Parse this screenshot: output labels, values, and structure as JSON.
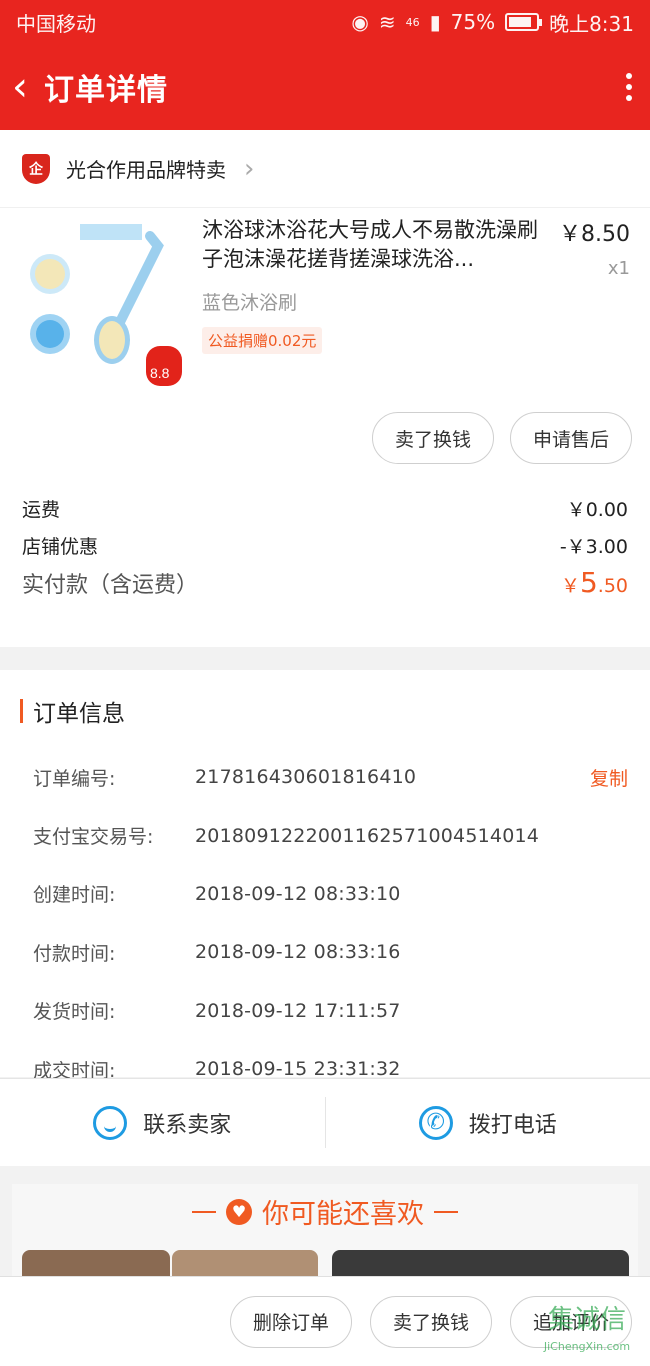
{
  "status": {
    "carrier": "中国移动",
    "network": "46",
    "battery": "75%",
    "time": "晚上8:31"
  },
  "nav": {
    "title": "订单详情"
  },
  "store": {
    "badge": "企",
    "name": "光合作用品牌特卖"
  },
  "product": {
    "title": "沐浴球沐浴花大号成人不易散洗澡刷子泡沫澡花搓背搓澡球洗浴...",
    "spec": "蓝色沐浴刷",
    "tag": "公益捐赠0.02元",
    "price": "￥8.50",
    "qty": "x1",
    "thumb_price_tag": "8.8"
  },
  "item_buttons": {
    "sell": "卖了换钱",
    "after_sale": "申请售后"
  },
  "fees": {
    "shipping_label": "运费",
    "shipping_value": "￥0.00",
    "discount_label": "店铺优惠",
    "discount_value": "-￥3.00",
    "paid_label": "实付款（含运费）",
    "paid_yen": "￥",
    "paid_int": "5",
    "paid_dec": ".50"
  },
  "order_info": {
    "title": "订单信息",
    "copy_label": "复制",
    "rows": [
      {
        "label": "订单编号:",
        "value": "217816430601816410"
      },
      {
        "label": "支付宝交易号:",
        "value": "2018091222001162571004514014"
      },
      {
        "label": "创建时间:",
        "value": "2018-09-12 08:33:10"
      },
      {
        "label": "付款时间:",
        "value": "2018-09-12 08:33:16"
      },
      {
        "label": "发货时间:",
        "value": "2018-09-12 17:11:57"
      },
      {
        "label": "成交时间:",
        "value": "2018-09-15 23:31:32"
      }
    ]
  },
  "contact": {
    "seller": "联系卖家",
    "phone": "拨打电话"
  },
  "recommend": {
    "title": "你可能还喜欢"
  },
  "bottom_buttons": {
    "delete": "删除订单",
    "sell": "卖了换钱",
    "review": "追加评价"
  },
  "watermark": {
    "text": "集诚信",
    "sub": "JiChengXin.com"
  },
  "colors": {
    "brand_red": "#e8251f",
    "accent_orange": "#f05a22",
    "link_blue": "#1e9be2"
  }
}
